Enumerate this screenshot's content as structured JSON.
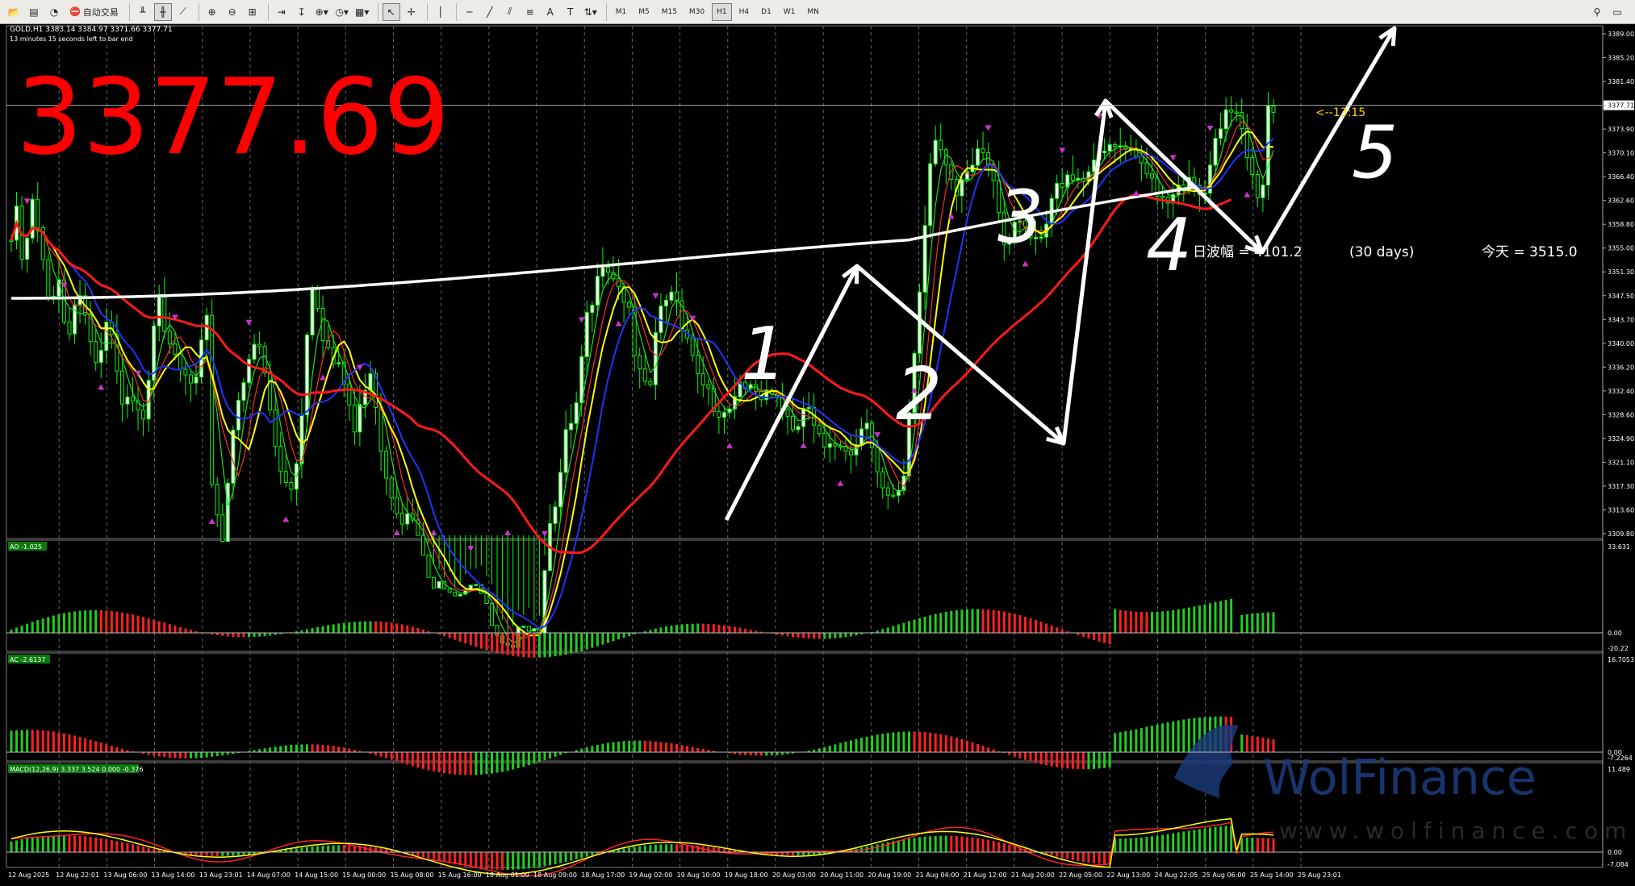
{
  "toolbar": {
    "autotrade_label": "自动交易",
    "timeframes": [
      "M1",
      "M5",
      "M15",
      "M30",
      "H1",
      "H4",
      "D1",
      "W1",
      "MN"
    ],
    "active_timeframe": "H1"
  },
  "chart": {
    "header_line": "GOLD,H1  3383.14 3384.97 3371.66 3377.71",
    "countdown": "13 minutes 15 seconds left to bar end",
    "big_price": "3377.69",
    "price_label": "3377.71",
    "timer_label": "<--13:15",
    "range_text": "日波幅 = 4101.2",
    "range_days": "(30 days)",
    "today_text": "今天 = 3515.0",
    "wave_labels": [
      "1",
      "2",
      "3",
      "4",
      "5"
    ],
    "price_ticks": [
      "3389.00",
      "3385.20",
      "3381.40",
      "3377.71",
      "3373.90",
      "3370.10",
      "3366.40",
      "3362.60",
      "3358.80",
      "3355.00",
      "3351.30",
      "3347.50",
      "3343.70",
      "3340.00",
      "3336.20",
      "3332.40",
      "3328.60",
      "3324.90",
      "3321.10",
      "3317.30",
      "3313.60",
      "3309.80"
    ],
    "time_ticks": [
      "12 Aug 2025",
      "12 Aug 22:01",
      "13 Aug 06:00",
      "13 Aug 14:00",
      "13 Aug 23:01",
      "14 Aug 07:00",
      "14 Aug 15:00",
      "15 Aug 00:00",
      "15 Aug 08:00",
      "15 Aug 16:00",
      "18 Aug 01:00",
      "18 Aug 09:00",
      "18 Aug 17:00",
      "19 Aug 02:00",
      "19 Aug 10:00",
      "19 Aug 18:00",
      "20 Aug 03:00",
      "20 Aug 11:00",
      "20 Aug 19:00",
      "21 Aug 04:00",
      "21 Aug 12:00",
      "21 Aug 20:00",
      "22 Aug 05:00",
      "22 Aug 13:00",
      "24 Aug 22:05",
      "25 Aug 06:00",
      "25 Aug 14:00",
      "25 Aug 23:01"
    ]
  },
  "indicators": {
    "ao": {
      "label": "AO -1.025",
      "ticks": [
        "33.631",
        "0.00",
        "-20.22"
      ]
    },
    "ac": {
      "label": "AC -2.6137",
      "ticks": [
        "16.7053",
        "0.00",
        "-7.2264"
      ]
    },
    "macd": {
      "label": "MACD(12,26,9) 3.337 3.524 0.000 -0.376",
      "ticks": [
        "11.489",
        "0.00",
        "-7.084"
      ]
    }
  },
  "watermark": {
    "brand": "WolFinance",
    "url": "www.wolfinance.com"
  },
  "colors": {
    "bg": "#000000",
    "candle": "#00ff00",
    "ma_white": "#ffffff",
    "ma_red": "#ff1a1a",
    "ma_yellow": "#ffff00",
    "ma_blue": "#2233ff",
    "green": "#22cc22",
    "red": "#ff2222",
    "fractal": "#cc33cc",
    "big_price": "#ff0000",
    "timer": "#ffd700"
  }
}
